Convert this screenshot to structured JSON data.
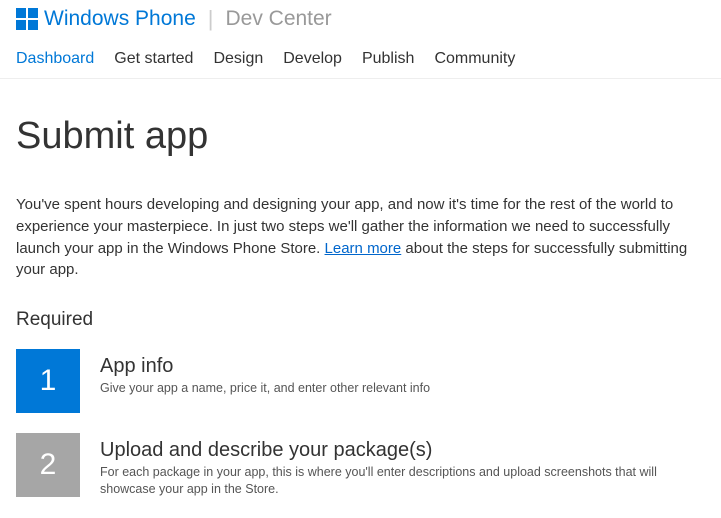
{
  "header": {
    "brand": "Windows Phone",
    "separator": "|",
    "sub_brand": "Dev Center"
  },
  "nav": {
    "items": [
      {
        "label": "Dashboard",
        "active": true
      },
      {
        "label": "Get started",
        "active": false
      },
      {
        "label": "Design",
        "active": false
      },
      {
        "label": "Develop",
        "active": false
      },
      {
        "label": "Publish",
        "active": false
      },
      {
        "label": "Community",
        "active": false
      }
    ]
  },
  "main": {
    "title": "Submit app",
    "intro_before": "You've spent hours developing and designing your app, and now it's time for the rest of the world to experience your masterpiece. In just two steps we'll gather the information we need to successfully launch your app in the Windows Phone Store. ",
    "learn_more": "Learn more",
    "intro_after": " about the steps for successfully submitting your app.",
    "required_label": "Required",
    "steps": [
      {
        "number": "1",
        "title": "App info",
        "desc": "Give your app a name, price it, and enter other relevant info",
        "active": true
      },
      {
        "number": "2",
        "title": "Upload and describe your package(s)",
        "desc": "For each package in your app, this is where you'll enter descriptions and upload screenshots that will showcase your app in the Store.",
        "active": false
      }
    ]
  }
}
